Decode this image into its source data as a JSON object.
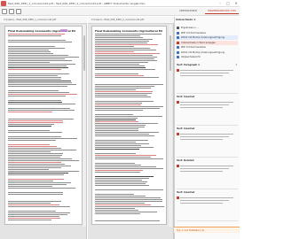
{
  "window": {
    "title": "Test_006_DMU_1_colored.indd.pdf - Test_006_DMU_2_colored.indd.pdf - ABBYY Dokumente vergleichen",
    "minimize": "–",
    "maximize": "□",
    "close": "✕"
  },
  "toolbar": {
    "tabs": [
      "UNTERSCHIEDE",
      "ERGEBNISSEN DES TYPS"
    ]
  },
  "left_pane": {
    "file": "C:\\Users\\...\\Test_006_DMU_1_colored.indd.pdf",
    "page_title": "Final Rulemaking Comments (Agricultural Mi"
  },
  "right_pane": {
    "file": "C:\\Users\\...\\Test_006_DMU_2_colored.indd.pdf",
    "page_title": "Final Rulemaking Comments (Agricultural Mi"
  },
  "side_panel": {
    "header": "Unterschiede: 1",
    "filters": [
      {
        "label": "Ergebnisse in ...",
        "color": "#555555"
      },
      {
        "label": "PDF mit Kommentaren",
        "color": "#3b6fc4"
      },
      {
        "label": "DOCX mit Modus Änderungsverfolgung",
        "color": "#3b6fc4"
      },
      {
        "label": "Unterschiede in Word anzeigen",
        "color": "#c03a2b"
      },
      {
        "label": "PDF mit Kommentaren",
        "color": "#3b6fc4"
      },
      {
        "label": "DOCX mit Modus Änderungsverfolgung",
        "color": "#3b6fc4"
      },
      {
        "label": "Vergleichsbericht",
        "color": "#3b6fc4"
      }
    ],
    "results": [
      {
        "title": "Text: Paragraph 1",
        "num": "1"
      },
      {
        "title": "Text: Inserted",
        "num": ""
      },
      {
        "title": "Text: Inserted",
        "num": ""
      },
      {
        "title": "Text: Deleted",
        "num": ""
      },
      {
        "title": "Text: Inserted",
        "num": ""
      }
    ],
    "footer": "Typ 1 und Fußzeilen (1)"
  },
  "colors": {
    "accent": "#c03a2b",
    "highlight": "#c47fd6",
    "selection": "#3b6fc4"
  }
}
